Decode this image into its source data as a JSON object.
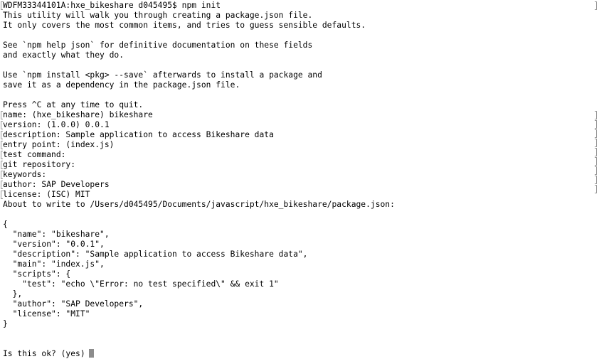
{
  "terminal": {
    "prompt": "WDFM33344101A:hxe_bikeshare d045495$ npm init",
    "intro_1": "This utility will walk you through creating a package.json file.",
    "intro_2": "It only covers the most common items, and tries to guess sensible defaults.",
    "help_1": "See `npm help json` for definitive documentation on these fields",
    "help_2": "and exactly what they do.",
    "install_1": "Use `npm install <pkg> --save` afterwards to install a package and",
    "install_2": "save it as a dependency in the package.json file.",
    "quit_hint": "Press ^C at any time to quit.",
    "answers": {
      "name": "name: (hxe_bikeshare) bikeshare",
      "version": "version: (1.0.0) 0.0.1",
      "description": "description: Sample application to access Bikeshare data",
      "entry_point": "entry point: (index.js)",
      "test_command": "test command:",
      "git_repository": "git repository:",
      "keywords": "keywords:",
      "author": "author: SAP Developers",
      "license": "license: (ISC) MIT"
    },
    "about_to_write": "About to write to /Users/d045495/Documents/javascript/hxe_bikeshare/package.json:",
    "json_preview": [
      "{",
      "  \"name\": \"bikeshare\",",
      "  \"version\": \"0.0.1\",",
      "  \"description\": \"Sample application to access Bikeshare data\",",
      "  \"main\": \"index.js\",",
      "  \"scripts\": {",
      "    \"test\": \"echo \\\"Error: no test specified\\\" && exit 1\"",
      "  },",
      "  \"author\": \"SAP Developers\",",
      "  \"license\": \"MIT\"",
      "}"
    ],
    "confirm_prompt": "Is this ok? (yes)"
  }
}
